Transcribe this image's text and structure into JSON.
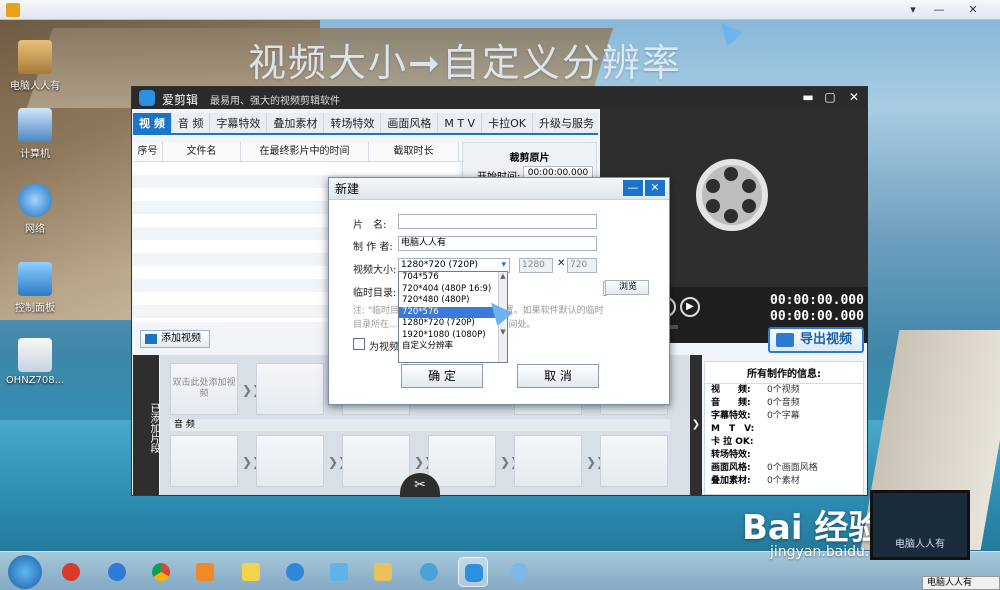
{
  "headline": "视频大小➞自定义分辨率",
  "desktop_icons": [
    "电脑人人有",
    "计算机",
    "网络",
    "控制面板",
    "OHNZ708..."
  ],
  "app": {
    "name": "爱剪辑",
    "slogan": "最易用、强大的视频剪辑软件",
    "tabs": [
      "视 频",
      "音 频",
      "字幕特效",
      "叠加素材",
      "转场特效",
      "画面风格",
      "M T V",
      "卡拉OK",
      "升级与服务"
    ],
    "columns": [
      "序号",
      "文件名",
      "在最终影片中的时间",
      "截取时长"
    ],
    "trim": {
      "title": "裁剪原片",
      "start_label": "开始时间:",
      "start_value": "00:00:00.000"
    },
    "timecode_1": "00:00:00.000",
    "timecode_2": "00:00:00.000",
    "export_label": "导出视频",
    "add_video_label": "添加视频",
    "clip_side_label": "已添加片段",
    "clip_hint": "双击此处添加视频",
    "audio_label": "音 频",
    "info": {
      "title": "所有制作的信息:",
      "rows": [
        {
          "k": "视　　频:",
          "v": "0个视频"
        },
        {
          "k": "音　　频:",
          "v": "0个音频"
        },
        {
          "k": "字幕特效:",
          "v": "0个字幕"
        },
        {
          "k": "M　T　V:",
          "v": ""
        },
        {
          "k": "卡 拉 OK:",
          "v": ""
        },
        {
          "k": "转场特效:",
          "v": ""
        },
        {
          "k": "画面风格:",
          "v": "0个画面风格"
        },
        {
          "k": "叠加素材:",
          "v": "0个素材"
        }
      ]
    }
  },
  "dialog": {
    "title": "新建",
    "name_label": "片　名:",
    "name_value": "",
    "author_label": "制 作 者:",
    "author_value": "电脑人人有",
    "size_label": "视频大小:",
    "size_value": "1280*720 (720P)",
    "width_value": "1280",
    "height_value": "720",
    "tempdir_label": "临时目录:",
    "browse_label": "浏览",
    "note_line1": "注: \"临时目录\"用于保存... 文件缓存位置。如果软件默认的临时",
    "note_line2": "目录所在... 可将其设定到更大的磁盘空间处。",
    "checkbox_label": "为视频自...",
    "ok_label": "确 定",
    "cancel_label": "取 消",
    "options": [
      "704*576",
      "720*404 (480P 16:9)",
      "720*480 (480P)",
      "720*576",
      "1280*720 (720P)",
      "1920*1080 (1080P)",
      "自定义分辨率"
    ],
    "selected_index": 3
  },
  "watermark": {
    "brand": "Bai 经验",
    "url": "jingyan.baidu.com",
    "laptop_text": "电脑人人有",
    "corner": "电脑人人有"
  }
}
